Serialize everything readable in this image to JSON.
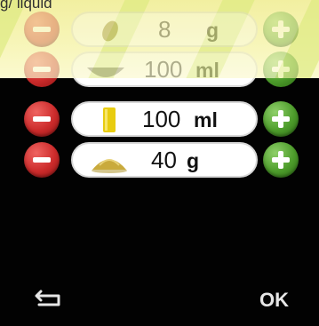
{
  "header": {
    "partial_text": "g/ liquid"
  },
  "rows": [
    {
      "qty": "8",
      "unit": "g"
    },
    {
      "qty": "100",
      "unit": "ml"
    },
    {
      "qty": "100",
      "unit": "ml"
    },
    {
      "qty": "40",
      "unit": "g"
    }
  ],
  "footer": {
    "ok_label": "OK"
  },
  "icons": {
    "back": "return-arrow-icon",
    "row_0": "seed-icon",
    "row_1": "bowl-icon",
    "row_2": "glass-icon",
    "row_3": "sugar-pile-icon"
  },
  "colors": {
    "minus": "#cc2b2b",
    "plus": "#4d9c2b",
    "background": "#020202",
    "overlay": "#f7f5b8"
  }
}
